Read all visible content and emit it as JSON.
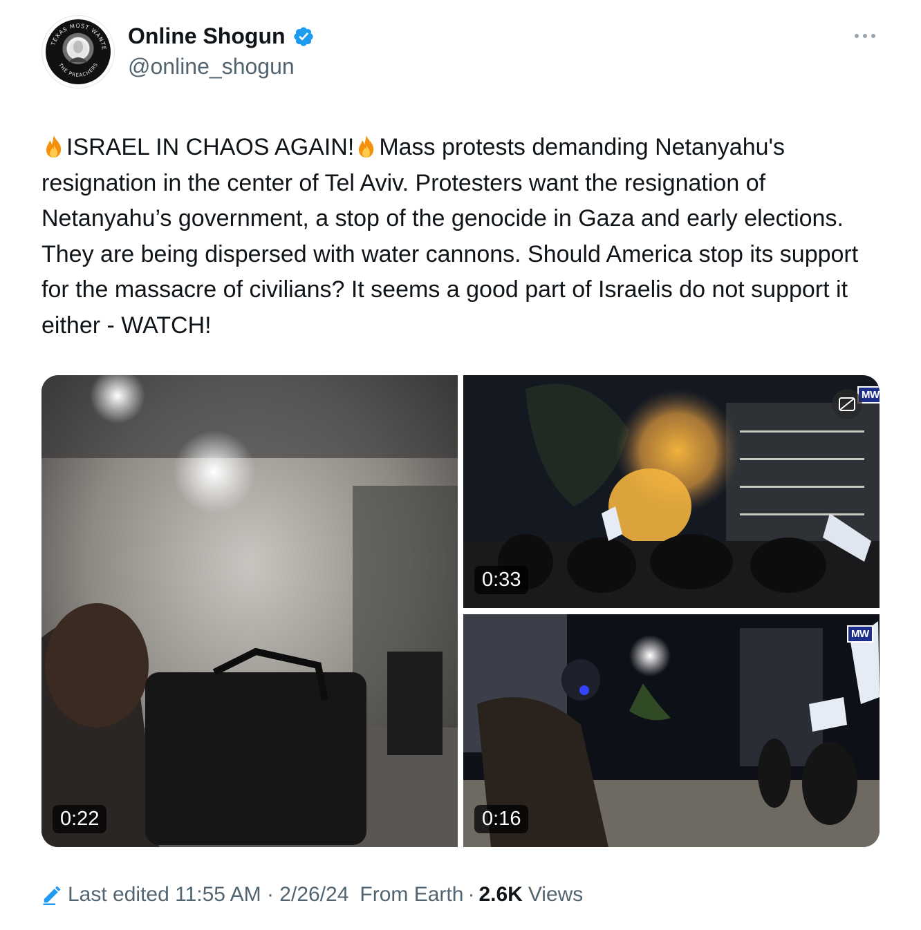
{
  "author": {
    "display_name": "Online Shogun",
    "handle": "@online_shogun",
    "verified": true,
    "verified_color": "#1d9bf0",
    "avatar_ring_text_top": "TEXAS MOST WANTED",
    "avatar_ring_text_bottom": "THE PREACHERS"
  },
  "tweet": {
    "part1": "ISRAEL IN CHAOS AGAIN!",
    "part2": "Mass protests demanding Netanyahu's resignation in the center of Tel Aviv. Protesters want the resignation of Netanyahu’s government, a stop of the genocide in Gaza and early elections. They are being dispersed with water cannons. Should America stop its support for the massacre of civilians? It seems a good part of Israelis do not support it either - WATCH!",
    "emoji_icon": "fire-icon"
  },
  "media": {
    "videos": [
      {
        "duration": "0:22"
      },
      {
        "duration": "0:33",
        "badge": "MW"
      },
      {
        "duration": "0:16",
        "badge": "MW"
      }
    ]
  },
  "footer": {
    "edited_label": "Last edited 11:55 AM · 2/26/24",
    "source": "From Earth",
    "separator": "·",
    "views_count": "2.6K",
    "views_label": "Views",
    "edit_icon": "pencil-icon",
    "edit_icon_color": "#1d9bf0"
  },
  "colors": {
    "text_primary": "#0f1419",
    "text_secondary": "#536471",
    "accent": "#1d9bf0"
  }
}
